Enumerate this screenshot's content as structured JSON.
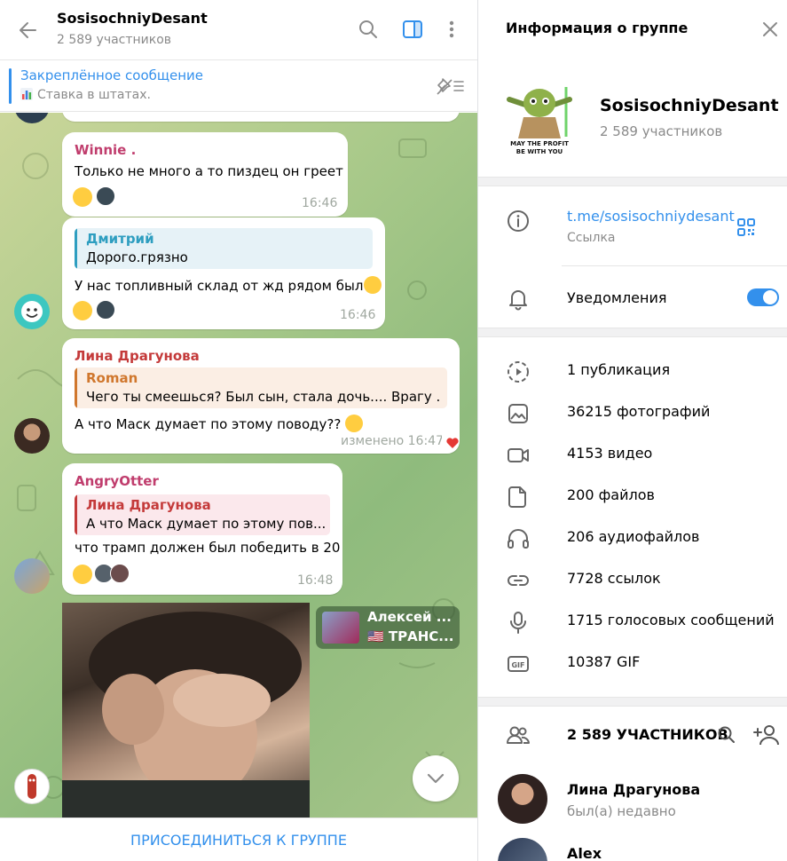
{
  "chat": {
    "title": "SosisochniyDesant",
    "subtitle": "2 589 участников",
    "pinned_title": "Закреплённое сообщение",
    "pinned_text": "Ставка в штатах.",
    "messages": [
      {
        "sender": "Winnie .",
        "text": "Только не много а то пиздец он греет",
        "time": "16:46"
      },
      {
        "reply_name": "Дмитрий",
        "reply_text": "Дорого.грязно",
        "text": "У нас топливный склад от жд рядом был",
        "time": "16:46"
      },
      {
        "sender": "Лина Драгунова",
        "reply_name": "Roman",
        "reply_text": "Чего ты смеешься?  Был сын, стала дочь.... Врагу ...",
        "text": "А что Маск думает по этому поводу??",
        "time": "изменено 16:47"
      },
      {
        "sender": "AngryOtter",
        "reply_name": "Лина Драгунова",
        "reply_text": "А что Маск думает по этому пов...",
        "text": "что трамп должен был победить в 20",
        "time": "16:48"
      }
    ],
    "forward": {
      "name": "Алексей ...",
      "text": "🇺🇸 ТРАНС..."
    },
    "join_label": "ПРИСОЕДИНИТЬСЯ К ГРУППЕ"
  },
  "info": {
    "title": "Информация о группе",
    "group_name": "SosisochniyDesant",
    "group_count": "2 589 участников",
    "avatar_caption_1": "MAY THE PROFIT",
    "avatar_caption_2": "BE WITH YOU",
    "link": "t.me/sosisochniydesant",
    "link_caption": "Ссылка",
    "notifications_label": "Уведомления",
    "notifications_on": true,
    "media": [
      {
        "icon": "stories-icon",
        "label": "1 публикация"
      },
      {
        "icon": "photo-icon",
        "label": "36215 фотографий"
      },
      {
        "icon": "video-icon",
        "label": "4153 видео"
      },
      {
        "icon": "file-icon",
        "label": "200 файлов"
      },
      {
        "icon": "headphones-icon",
        "label": "206 аудиофайлов"
      },
      {
        "icon": "link-icon",
        "label": "7728 ссылок"
      },
      {
        "icon": "microphone-icon",
        "label": "1715 голосовых сообщений"
      },
      {
        "icon": "gif-icon",
        "label": "10387 GIF"
      }
    ],
    "members_title": "2 589 УЧАСТНИКОВ",
    "members": [
      {
        "name": "Лина Драгунова",
        "status": "был(а) недавно"
      },
      {
        "name": "Alex",
        "status": ""
      }
    ]
  },
  "colors": {
    "accent": "#3390ec",
    "winnie": "#c03d6d",
    "dmitriy": "#2e9ec0",
    "lina": "#c43a3a",
    "roman": "#d0772d",
    "otter": "#c03d6d"
  }
}
